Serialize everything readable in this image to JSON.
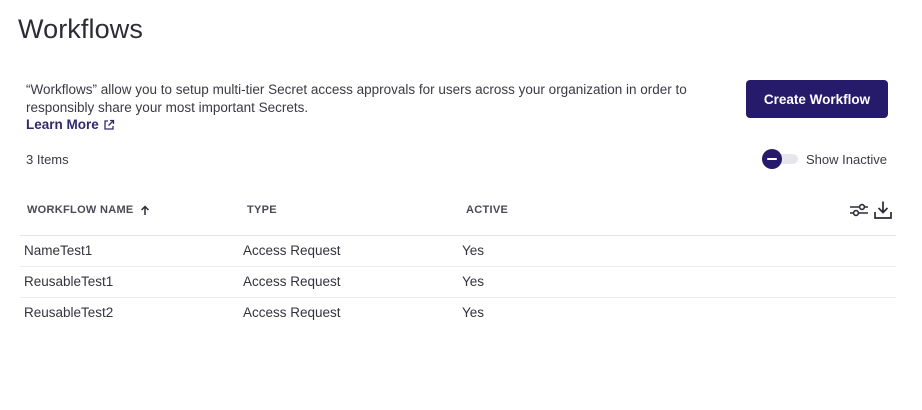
{
  "page": {
    "title": "Workflows"
  },
  "intro": {
    "description": "“Workflows” allow you to setup multi-tier Secret access approvals for users across your organization in order to responsibly share your most important Secrets.",
    "learn_more_label": "Learn More",
    "learn_more_icon": "external-link-icon"
  },
  "toolbar": {
    "create_label": "Create Workflow",
    "items_count": "3 Items",
    "show_inactive_label": "Show Inactive",
    "show_inactive_on": false
  },
  "table": {
    "columns": [
      {
        "label": "WORKFLOW NAME",
        "sort": "ascending",
        "sort_icon": "arrow-up-icon"
      },
      {
        "label": "TYPE"
      },
      {
        "label": "ACTIVE"
      }
    ],
    "tools": [
      "column-settings-icon",
      "download-icon"
    ],
    "rows": [
      {
        "name": "NameTest1",
        "type": "Access Request",
        "active": "Yes"
      },
      {
        "name": "ReusableTest1",
        "type": "Access Request",
        "active": "Yes"
      },
      {
        "name": "ReusableTest2",
        "type": "Access Request",
        "active": "Yes"
      }
    ]
  },
  "colors": {
    "primary": "#261a6b",
    "link": "#2f2a6e",
    "divider": "#e3e3e8"
  }
}
